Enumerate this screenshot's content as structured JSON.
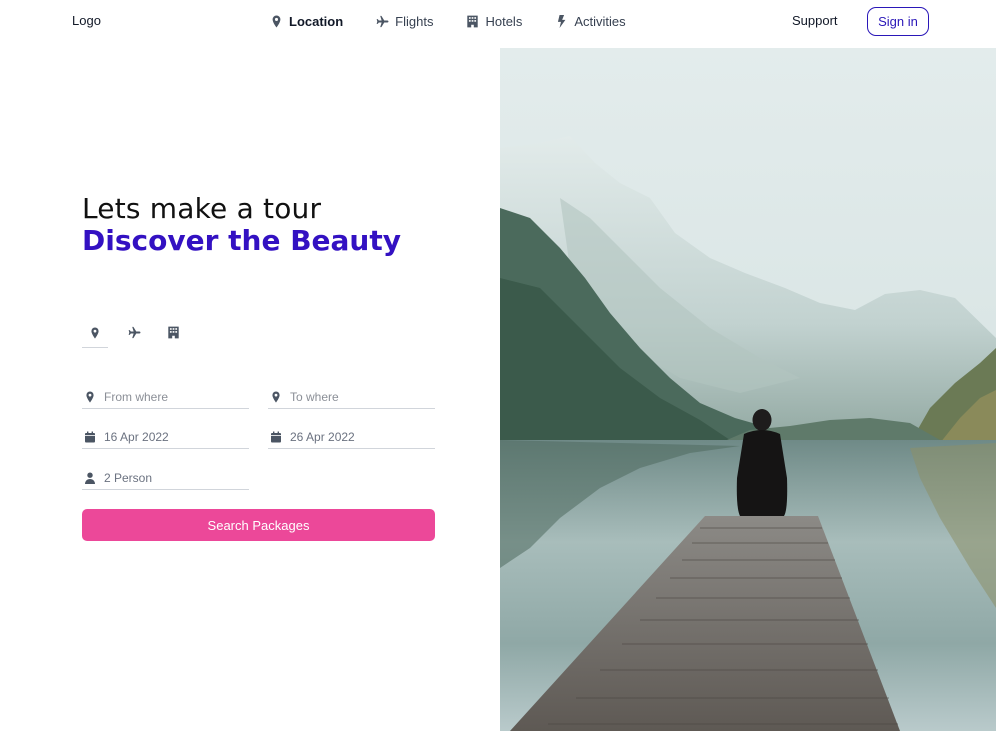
{
  "header": {
    "logo": "Logo",
    "nav": [
      {
        "label": "Location",
        "icon": "map-pin-icon",
        "active": true
      },
      {
        "label": "Flights",
        "icon": "plane-icon",
        "active": false
      },
      {
        "label": "Hotels",
        "icon": "building-icon",
        "active": false
      },
      {
        "label": "Activities",
        "icon": "bolt-icon",
        "active": false
      }
    ],
    "support": "Support",
    "signin": "Sign in"
  },
  "hero": {
    "line1": "Lets make a tour",
    "line2": "Discover the Beauty"
  },
  "modes": [
    "map-pin-icon",
    "plane-icon",
    "building-icon"
  ],
  "form": {
    "from_placeholder": "From where",
    "to_placeholder": "To where",
    "start_date": "16 Apr 2022",
    "end_date": "26 Apr 2022",
    "guests": "2 Person",
    "submit": "Search Packages"
  },
  "photo": {
    "subject": "person-sitting-on-wooden-pier-by-mountain-lake"
  },
  "colors": {
    "accent": "#3311c2",
    "button": "#ec4899",
    "icon": "#4b5563"
  }
}
